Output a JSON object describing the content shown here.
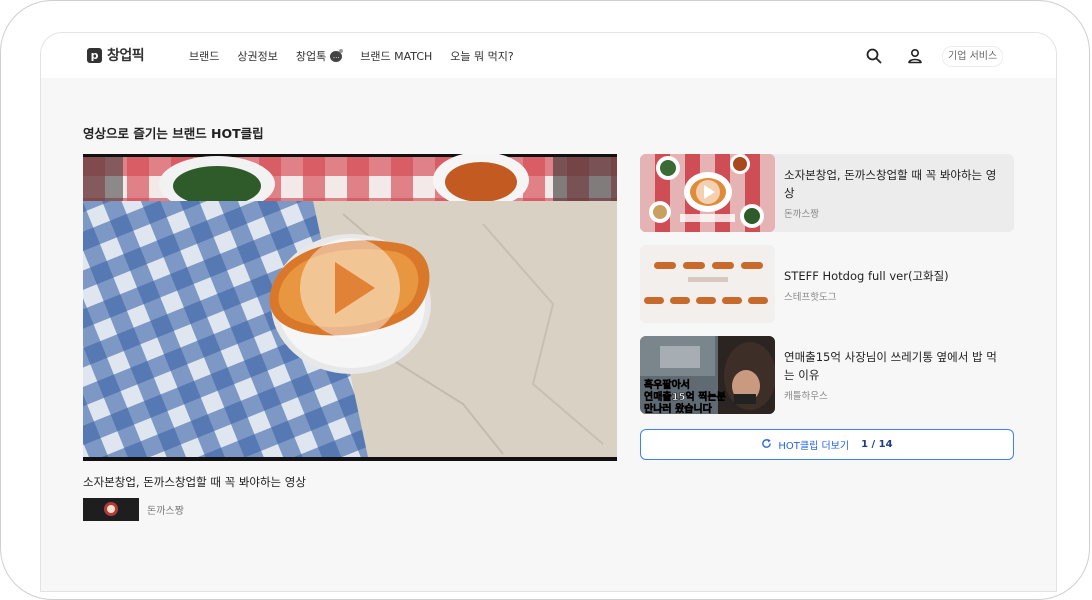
{
  "header": {
    "logo_mark": "p",
    "logo_text": "창업픽",
    "nav": [
      "브랜드",
      "상권정보",
      "창업톡",
      "브랜드 MATCH",
      "오늘 뭐 먹지?"
    ],
    "biz_button": "기업 서비스",
    "icons": {
      "search": "search-icon",
      "user": "user-icon",
      "chat": "chat-bubble-icon"
    }
  },
  "section": {
    "title": "영상으로 즐기는 브랜드 HOT클립"
  },
  "featured": {
    "title": "소자본창업, 돈까스창업할 때 꼭 봐야하는 영상",
    "channel": "돈까스짱"
  },
  "clips": [
    {
      "title": "소자본창업, 돈까스창업할 때 꼭 봐야하는 영상",
      "channel": "돈까스짱"
    },
    {
      "title": "STEFF Hotdog full ver(고화질)",
      "channel": "스테프핫도그"
    },
    {
      "title": "연매출15억 사장님이 쓰레기통 옆에서 밥 먹는 이유",
      "channel": "캐틀하우스",
      "thumb_caption_1": "흑우팔아서",
      "thumb_caption_2": "연매출15억 찍는분",
      "thumb_caption_3": "만나러 왔습니다"
    }
  ],
  "more": {
    "label": "HOT클립 더보기",
    "count": "1 / 14"
  },
  "colors": {
    "accent": "#2563eb",
    "play": "#ffffff"
  }
}
